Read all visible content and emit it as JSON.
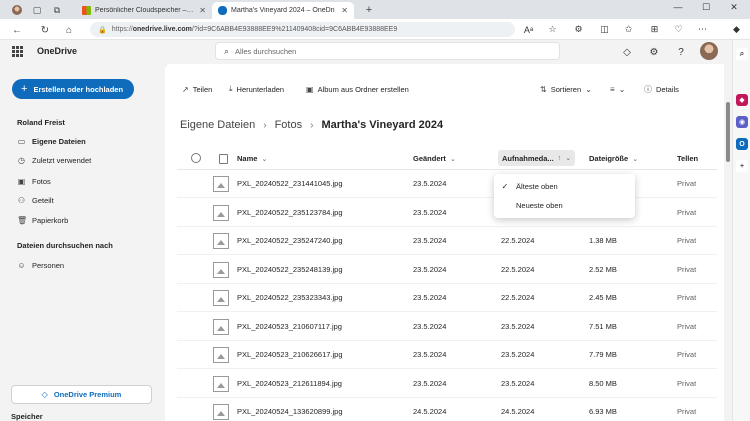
{
  "browser": {
    "tabs": [
      {
        "label": "Persönlicher Cloudspeicher – Mic",
        "active": false
      },
      {
        "label": "Martha's Vineyard 2024 – OneDri",
        "active": true
      }
    ],
    "new_tab": "+",
    "url_prefix": "https://",
    "url_domain": "onedrive.live.com",
    "url_rest": "/?id=9C6ABB4E93888EE9%211409408cid=9C6ABB4E93888EE9",
    "window_controls": [
      "—",
      "☐",
      "✕"
    ]
  },
  "header": {
    "app_title": "OneDrive",
    "search_placeholder": "Alles durchsuchen"
  },
  "sidebar": {
    "create_button": "Erstellen oder hochladen",
    "user_name": "Roland Freist",
    "items": [
      {
        "label": "Eigene Dateien",
        "icon": "folder-icon",
        "glyph": "▭",
        "selected": true
      },
      {
        "label": "Zuletzt verwendet",
        "icon": "clock-icon",
        "glyph": "◷",
        "selected": false
      },
      {
        "label": "Fotos",
        "icon": "photo-icon",
        "glyph": "▣",
        "selected": false
      },
      {
        "label": "Geteilt",
        "icon": "people-icon",
        "glyph": "⚇",
        "selected": false
      },
      {
        "label": "Papierkorb",
        "icon": "trash-icon",
        "glyph": "🗑",
        "selected": false
      }
    ],
    "browse_heading": "Dateien durchsuchen nach",
    "browse_items": [
      {
        "label": "Personen",
        "icon": "person-icon",
        "glyph": "☺"
      }
    ],
    "premium_button": "OneDrive Premium",
    "storage_label": "Speicher"
  },
  "toolbar": {
    "share": "Teilen",
    "download": "Herunterladen",
    "album": "Album aus Ordner erstellen",
    "sort": "Sortieren",
    "details": "Details"
  },
  "breadcrumb": {
    "items": [
      "Eigene Dateien",
      "Fotos"
    ],
    "current": "Martha's Vineyard 2024"
  },
  "table": {
    "columns": {
      "name": "Name",
      "modified": "Geändert",
      "taken": "Aufnahmeda...",
      "size": "Dateigröße",
      "share": "Tellen"
    },
    "rows": [
      {
        "name": "PXL_20240522_231441045.jpg",
        "modified": "23.5.2024",
        "taken": "",
        "size": "",
        "share": "Privat"
      },
      {
        "name": "PXL_20240522_235123784.jpg",
        "modified": "23.5.2024",
        "taken": "",
        "size": "",
        "share": "Privat"
      },
      {
        "name": "PXL_20240522_235247240.jpg",
        "modified": "23.5.2024",
        "taken": "22.5.2024",
        "size": "1.38 MB",
        "share": "Privat"
      },
      {
        "name": "PXL_20240522_235248139.jpg",
        "modified": "23.5.2024",
        "taken": "22.5.2024",
        "size": "2.52 MB",
        "share": "Privat"
      },
      {
        "name": "PXL_20240522_235323343.jpg",
        "modified": "23.5.2024",
        "taken": "22.5.2024",
        "size": "2.45 MB",
        "share": "Privat"
      },
      {
        "name": "PXL_20240523_210607117.jpg",
        "modified": "23.5.2024",
        "taken": "23.5.2024",
        "size": "7.51 MB",
        "share": "Privat"
      },
      {
        "name": "PXL_20240523_210626617.jpg",
        "modified": "23.5.2024",
        "taken": "23.5.2024",
        "size": "7.79 MB",
        "share": "Privat"
      },
      {
        "name": "PXL_20240523_212611894.jpg",
        "modified": "23.5.2024",
        "taken": "23.5.2024",
        "size": "8.50 MB",
        "share": "Privat"
      },
      {
        "name": "PXL_20240524_133620899.jpg",
        "modified": "24.5.2024",
        "taken": "24.5.2024",
        "size": "6.93 MB",
        "share": "Privat"
      }
    ]
  },
  "sort_menu": {
    "items": [
      {
        "label": "Älteste oben",
        "checked": true
      },
      {
        "label": "Neueste oben",
        "checked": false
      }
    ]
  },
  "colors": {
    "accent": "#0f6cbd",
    "background": "#f3f3f3",
    "surface": "#ffffff"
  }
}
